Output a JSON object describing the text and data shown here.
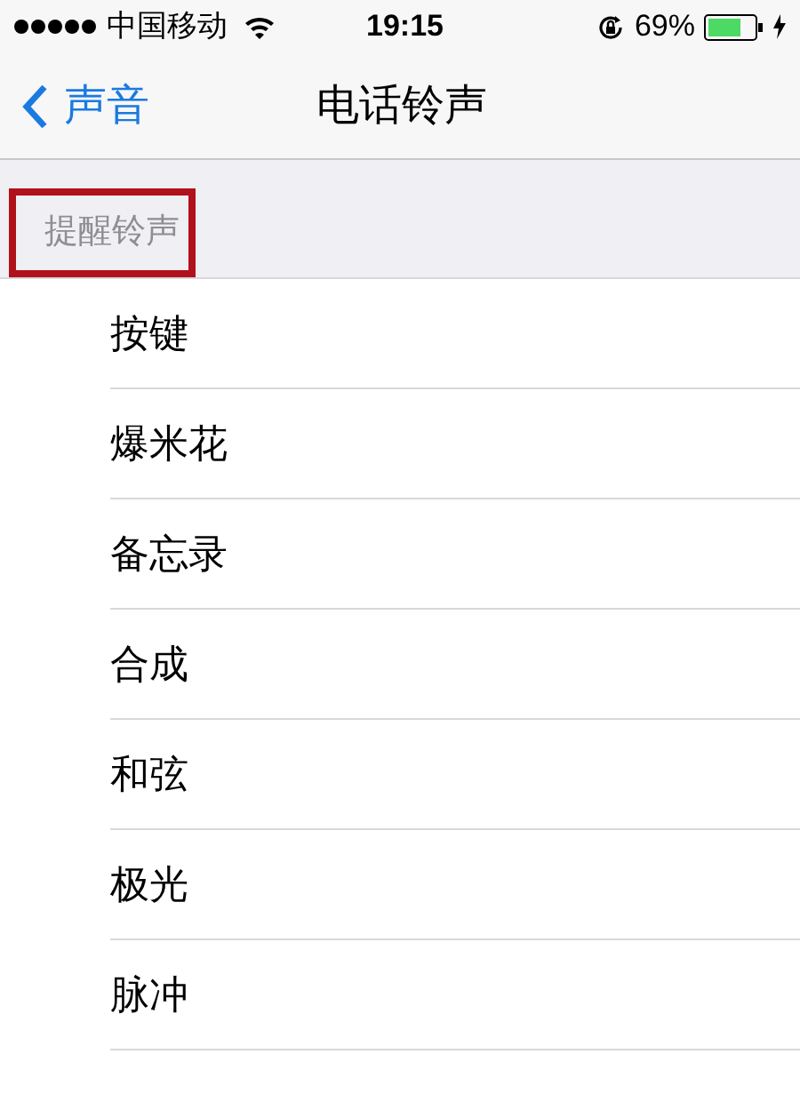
{
  "status_bar": {
    "carrier": "中国移动",
    "time": "19:15",
    "battery": "69%"
  },
  "nav": {
    "back": "声音",
    "title": "电话铃声"
  },
  "section": {
    "title": "提醒铃声",
    "highlighted": true
  },
  "items": [
    "按键",
    "爆米花",
    "备忘录",
    "合成",
    "和弦",
    "极光",
    "脉冲"
  ]
}
